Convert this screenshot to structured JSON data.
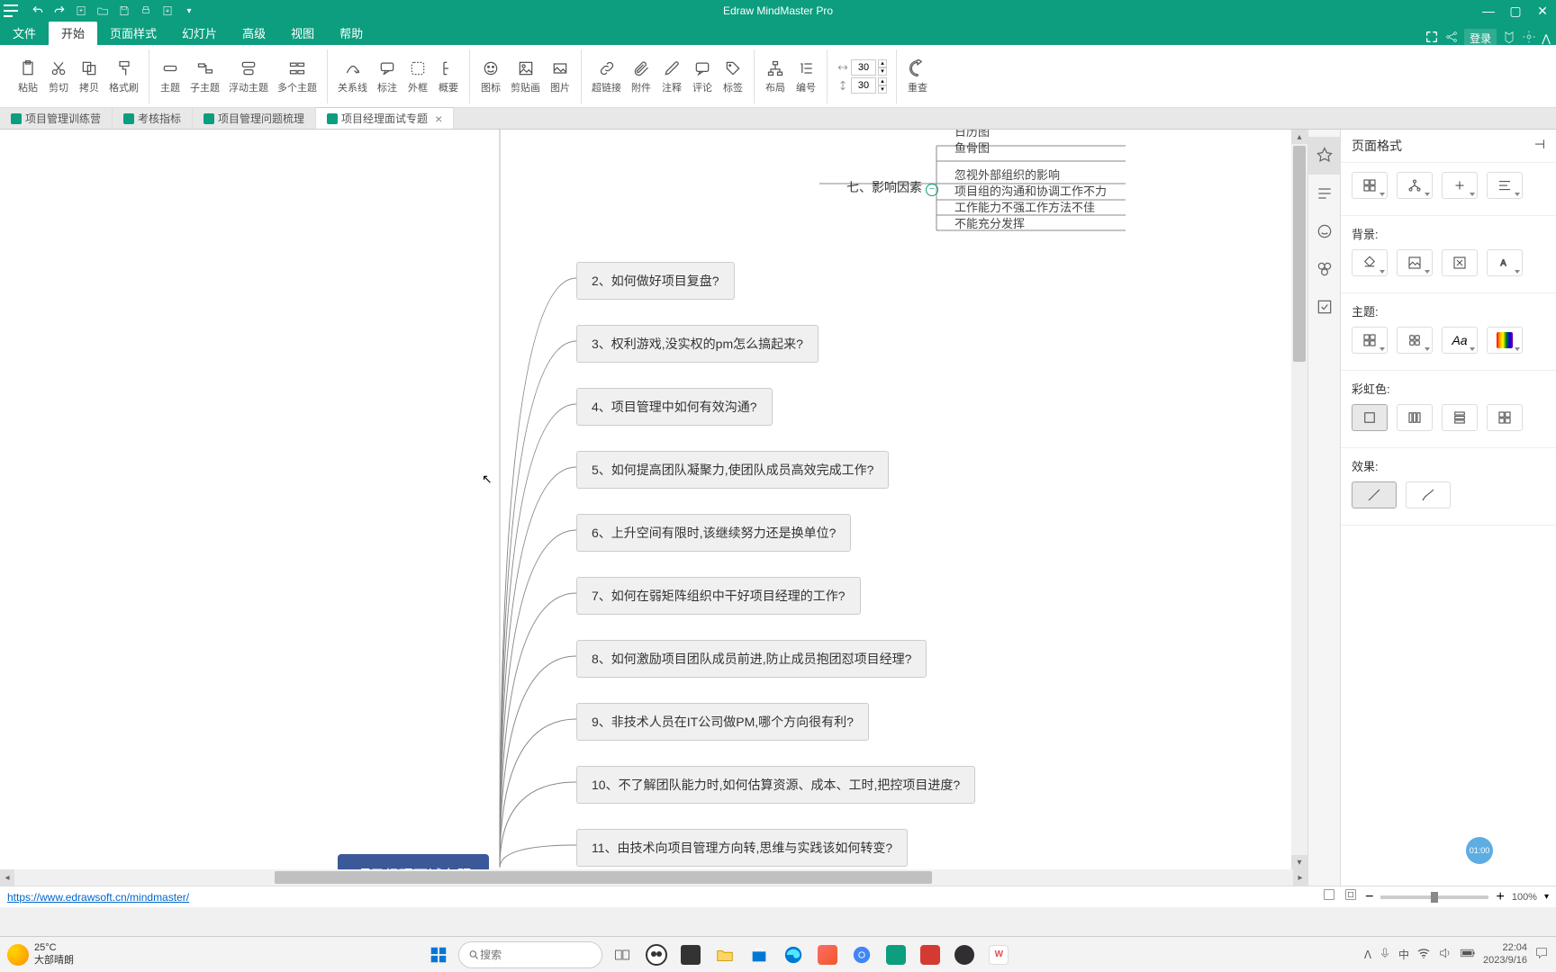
{
  "app_title": "Edraw MindMaster Pro",
  "qat": [
    "undo",
    "redo",
    "new",
    "open",
    "save",
    "print",
    "export"
  ],
  "menu": {
    "items": [
      "文件",
      "开始",
      "页面样式",
      "幻灯片",
      "高级",
      "视图",
      "帮助"
    ],
    "active_index": 1
  },
  "login_label": "登录",
  "ribbon": {
    "groups": [
      {
        "name": "clipboard",
        "buttons": [
          {
            "id": "paste",
            "label": "粘贴"
          },
          {
            "id": "cut",
            "label": "剪切"
          },
          {
            "id": "copy",
            "label": "拷贝"
          },
          {
            "id": "format-painter",
            "label": "格式刷"
          }
        ]
      },
      {
        "name": "topics",
        "buttons": [
          {
            "id": "topic",
            "label": "主题"
          },
          {
            "id": "subtopic",
            "label": "子主题"
          },
          {
            "id": "floating",
            "label": "浮动主题"
          },
          {
            "id": "multiple",
            "label": "多个主题"
          }
        ]
      },
      {
        "name": "relations",
        "buttons": [
          {
            "id": "relationship",
            "label": "关系线"
          },
          {
            "id": "callout",
            "label": "标注"
          },
          {
            "id": "boundary",
            "label": "外框"
          },
          {
            "id": "summary",
            "label": "概要"
          }
        ]
      },
      {
        "name": "insert",
        "buttons": [
          {
            "id": "icon",
            "label": "图标"
          },
          {
            "id": "clipart",
            "label": "剪贴画"
          },
          {
            "id": "picture",
            "label": "图片"
          }
        ]
      },
      {
        "name": "attach",
        "buttons": [
          {
            "id": "hyperlink",
            "label": "超链接"
          },
          {
            "id": "attachment",
            "label": "附件"
          },
          {
            "id": "note",
            "label": "注释"
          },
          {
            "id": "comment",
            "label": "评论"
          },
          {
            "id": "tag",
            "label": "标签"
          }
        ]
      },
      {
        "name": "layout",
        "buttons": [
          {
            "id": "layout",
            "label": "布局"
          },
          {
            "id": "number",
            "label": "编号"
          }
        ]
      },
      {
        "name": "size",
        "spinner1": "30",
        "spinner2": "30"
      },
      {
        "name": "review",
        "buttons": [
          {
            "id": "review",
            "label": "重查"
          }
        ]
      }
    ]
  },
  "doc_tabs": [
    {
      "label": "项目管理训练营",
      "active": false
    },
    {
      "label": "考核指标",
      "active": false
    },
    {
      "label": "项目管理问题梳理",
      "active": false
    },
    {
      "label": "项目经理面试专题",
      "active": true
    }
  ],
  "mindmap": {
    "center": "项目经理面试专题",
    "section7": {
      "label": "七、影响因素",
      "sub": [
        "日历图",
        "鱼骨图",
        "忽视外部组织的影响",
        "项目组的沟通和协调工作不力",
        "工作能力不强工作方法不佳",
        "不能充分发挥"
      ]
    },
    "nodes": [
      "2、如何做好项目复盘?",
      "3、权利游戏,没实权的pm怎么搞起来?",
      "4、项目管理中如何有效沟通?",
      "5、如何提高团队凝聚力,使团队成员高效完成工作?",
      "6、上升空间有限时,该继续努力还是换单位?",
      "7、如何在弱矩阵组织中干好项目经理的工作?",
      "8、如何激励项目团队成员前进,防止成员抱团怼项目经理?",
      "9、非技术人员在IT公司做PM,哪个方向很有利?",
      "10、不了解团队能力时,如何估算资源、成本、工时,把控项目进度?",
      "11、由技术向项目管理方向转,思维与实践该如何转变?"
    ]
  },
  "format_panel": {
    "title": "页面格式",
    "sections": {
      "background": "背景:",
      "theme": "主题:",
      "rainbow": "彩虹色:",
      "effect": "效果:"
    }
  },
  "status": {
    "link": "https://www.edrawsoft.cn/mindmaster/",
    "zoom": "100%"
  },
  "float_badge": "01:00",
  "taskbar": {
    "weather_temp": "25°C",
    "weather_desc": "大部晴朗",
    "search_placeholder": "搜索",
    "time": "22:04",
    "date": "2023/9/16",
    "ime": "中"
  }
}
